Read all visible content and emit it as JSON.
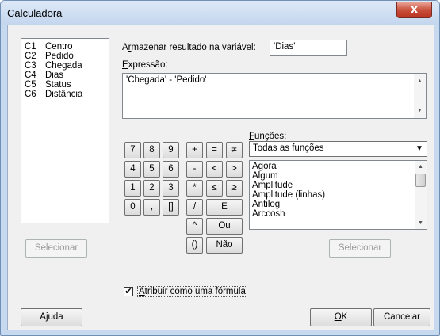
{
  "window": {
    "title": "Calculadora",
    "close_glyph": "x"
  },
  "variables": [
    {
      "col": "C1",
      "name": "Centro"
    },
    {
      "col": "C2",
      "name": "Pedido"
    },
    {
      "col": "C3",
      "name": "Chegada"
    },
    {
      "col": "C4",
      "name": "Dias"
    },
    {
      "col": "C5",
      "name": "Status"
    },
    {
      "col": "C6",
      "name": "Distância"
    }
  ],
  "store": {
    "label_pre": "A",
    "label_key": "r",
    "label_post": "mazenar resultado na variável:",
    "value": "'Dias'"
  },
  "expression": {
    "label_key": "E",
    "label_post": "xpressão:",
    "value": "'Chegada' - 'Pedido'"
  },
  "keypad": {
    "r1": [
      "7",
      "8",
      "9",
      "+",
      "=",
      "≠"
    ],
    "r2": [
      "4",
      "5",
      "6",
      "-",
      "<",
      ">"
    ],
    "r3": [
      "1",
      "2",
      "3",
      "*",
      "≤",
      "≥"
    ],
    "r4a": [
      "0",
      ",",
      "[]",
      "/"
    ],
    "r4e": "E",
    "r5a": "^",
    "r5b": "Ou",
    "r6a": "()",
    "r6b": "Não"
  },
  "functions": {
    "label_key": "F",
    "label_post": "unções:",
    "selected": "Todas as funções",
    "items": [
      "Agora",
      "Algum",
      "Amplitude",
      "Amplitude (linhas)",
      "Antilog",
      "Arccosh"
    ]
  },
  "buttons": {
    "select_left": "Selecionar",
    "select_right": "Selecionar",
    "help": "Ajuda",
    "ok_key": "O",
    "ok_post": "K",
    "cancel": "Cancelar"
  },
  "formula": {
    "checked_glyph": "✔",
    "label_key": "A",
    "label_post": "tribuir como uma fórmula"
  }
}
